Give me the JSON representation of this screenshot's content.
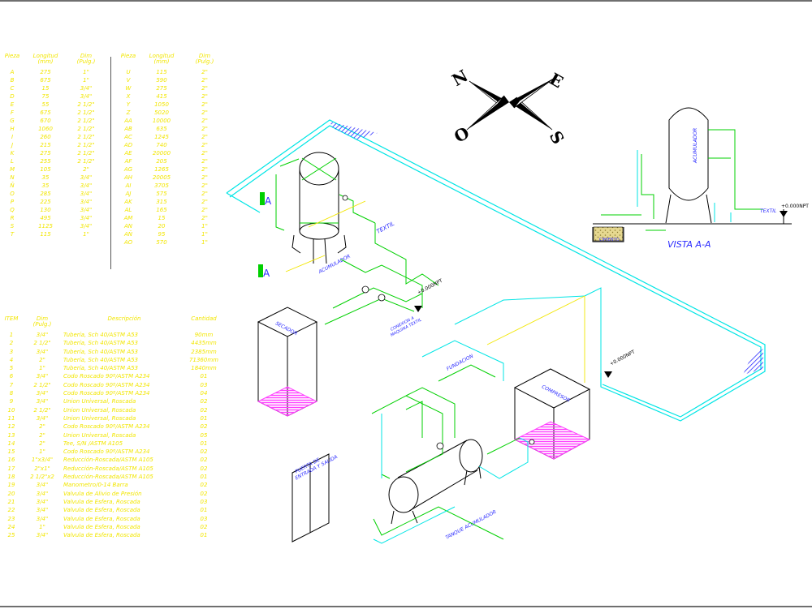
{
  "pieces_table": {
    "left": {
      "headers": {
        "pieza": "Pieza",
        "longitud": "Longitud\n(mm)",
        "dim": "Dim\n(Pulg.)"
      },
      "rows": [
        [
          "A",
          "275",
          "1\""
        ],
        [
          "B",
          "675",
          "1\""
        ],
        [
          "C",
          "15",
          "3/4\""
        ],
        [
          "D",
          "75",
          "3/4\""
        ],
        [
          "E",
          "55",
          "2 1/2\""
        ],
        [
          "F",
          "675",
          "2 1/2\""
        ],
        [
          "G",
          "670",
          "2 1/2\""
        ],
        [
          "H",
          "1060",
          "2 1/2\""
        ],
        [
          "I",
          "260",
          "2 1/2\""
        ],
        [
          "J",
          "215",
          "2 1/2\""
        ],
        [
          "K",
          "275",
          "2 1/2\""
        ],
        [
          "L",
          "255",
          "2 1/2\""
        ],
        [
          "M",
          "105",
          "2\""
        ],
        [
          "N",
          "35",
          "3/4\""
        ],
        [
          "Ñ",
          "35",
          "3/4\""
        ],
        [
          "O",
          "285",
          "3/4\""
        ],
        [
          "P",
          "225",
          "3/4\""
        ],
        [
          "Q",
          "130",
          "3/4\""
        ],
        [
          "R",
          "495",
          "3/4\""
        ],
        [
          "S",
          "1125",
          "3/4\""
        ],
        [
          "T",
          "115",
          "1\""
        ]
      ]
    },
    "right": {
      "headers": {
        "pieza": "Pieza",
        "longitud": "Longitud\n(mm)",
        "dim": "Dim\n(Pulg.)"
      },
      "rows": [
        [
          "U",
          "115",
          "2\""
        ],
        [
          "V",
          "590",
          "2\""
        ],
        [
          "W",
          "275",
          "2\""
        ],
        [
          "X",
          "415",
          "2\""
        ],
        [
          "Y",
          "1050",
          "2\""
        ],
        [
          "Z",
          "5020",
          "2\""
        ],
        [
          "AA",
          "10000",
          "2\""
        ],
        [
          "AB",
          "635",
          "2\""
        ],
        [
          "AC",
          "1245",
          "2\""
        ],
        [
          "AD",
          "740",
          "2\""
        ],
        [
          "AE",
          "20000",
          "2\""
        ],
        [
          "AF",
          "205",
          "2\""
        ],
        [
          "AG",
          "1265",
          "2\""
        ],
        [
          "AH",
          "20005",
          "2\""
        ],
        [
          "AI",
          "3705",
          "2\""
        ],
        [
          "AJ",
          "575",
          "2\""
        ],
        [
          "AK",
          "315",
          "2\""
        ],
        [
          "AL",
          "165",
          "2\""
        ],
        [
          "AM",
          "15",
          "2\""
        ],
        [
          "AN",
          "20",
          "1\""
        ],
        [
          "AÑ",
          "95",
          "1\""
        ],
        [
          "AO",
          "570",
          "1\""
        ]
      ]
    }
  },
  "items_table": {
    "headers": {
      "item": "ITEM",
      "dim": "Dim\n(Pulg.)",
      "descripcion": "Descripción",
      "cantidad": "Cantidad"
    },
    "rows": [
      [
        "1",
        "3/4\"",
        "Tubería, Sch 40/ASTM A53",
        "90mm"
      ],
      [
        "2",
        "2 1/2\"",
        "Tubería, Sch 40/ASTM A53",
        "4435mm"
      ],
      [
        "3",
        "3/4\"",
        "Tubería, Sch 40/ASTM A53",
        "2385mm"
      ],
      [
        "4",
        "2\"",
        "Tubería, Sch 40/ASTM A53",
        "71360mm"
      ],
      [
        "5",
        "1\"",
        "Tubería, Sch 40/ASTM A53",
        "1840mm"
      ],
      [
        "6",
        "3/4\"",
        "Codo Roscado 90º/ASTM A234",
        "01"
      ],
      [
        "7",
        "2 1/2\"",
        "Codo Roscado 90º/ASTM A234",
        "03"
      ],
      [
        "8",
        "3/4\"",
        "Codo Roscado 90º/ASTM A234",
        "04"
      ],
      [
        "9",
        "3/4\"",
        "Union Universal, Roscada",
        "02"
      ],
      [
        "10",
        "2 1/2\"",
        "Union Universal, Roscada",
        "02"
      ],
      [
        "11",
        "3/4\"",
        "Union Universal, Roscada",
        "01"
      ],
      [
        "12",
        "2\"",
        "Codo Roscado 90º/ASTM A234",
        "02"
      ],
      [
        "13",
        "2\"",
        "Union Universal, Roscada",
        "05"
      ],
      [
        "14",
        "2\"",
        "Tee, S/N /ASTM A105",
        "01"
      ],
      [
        "15",
        "1\"",
        "Codo Roscado 90º/ASTM A234",
        "02"
      ],
      [
        "16",
        "1\"x3/4\"",
        "Reducción-Roscada/ASTM A105",
        "02"
      ],
      [
        "17",
        "2\"x1\"",
        "Reducción-Roscada/ASTM A105",
        "02"
      ],
      [
        "18",
        "2 1/2\"x2",
        "Reducción-Roscada/ASTM A105",
        "01"
      ],
      [
        "19",
        "3/4\"",
        "Manometro/0-14 Barra",
        "02"
      ],
      [
        "20",
        "3/4\"",
        "Valvula de Alivio de Presión",
        "02"
      ],
      [
        "21",
        "3/4\"",
        "Valvula de Esfera, Roscada",
        "03"
      ],
      [
        "22",
        "3/4\"",
        "Valvula de Esfera, Roscada",
        "01"
      ],
      [
        "23",
        "3/4\"",
        "Valvula de Esfera, Roscada",
        "03"
      ],
      [
        "24",
        "1\"",
        "Valvula de Esfera, Roscada",
        "02"
      ],
      [
        "25",
        "3/4\"",
        "Valvula de Esfera, Roscada",
        "01"
      ]
    ]
  },
  "compass": {
    "n": "N",
    "e": "E",
    "s": "S",
    "o": "O"
  },
  "labels": {
    "acumulador": "ACUMULADOR",
    "secador": "SECADOR",
    "compresor": "COMPRESOR",
    "tanque": "TANQUE ACUMULADOR",
    "fundacion": "FUNDACION",
    "textil": "TEXTIL",
    "conexion": "CONEXION A\nMAQUINA TEXTIL",
    "puerta": "PUERTA DE\nENTRADA Y SALIDA",
    "cota1": "+0.000NPT",
    "cota2": "+0.000NPT",
    "cota3": "+0.000NPT",
    "vista": "VISTA  A-A",
    "section_a1": "A",
    "section_a2": "A",
    "cimiento": "CIMIENTO",
    "acum_side": "ACUMULADOR",
    "textil_side": "TEXTIL"
  },
  "colors": {
    "pipe_cyan": "#00e5e5",
    "pipe_green": "#00d000",
    "text_yellow": "#f2e600",
    "label_blue": "#2a2aff",
    "hatch_magenta": "#ff40ff",
    "outline": "#000000"
  }
}
